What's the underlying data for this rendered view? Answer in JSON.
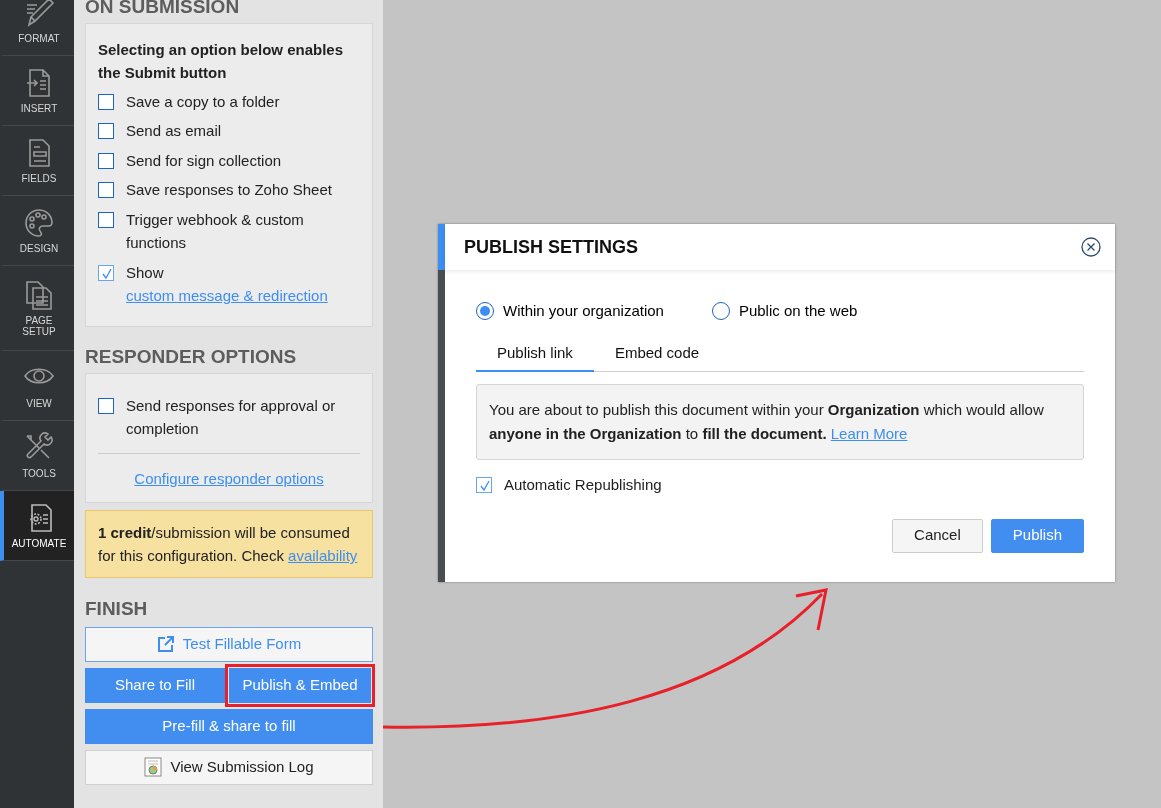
{
  "sidebar": {
    "items": [
      {
        "label": "FORMAT",
        "selected": false
      },
      {
        "label": "INSERT",
        "selected": false
      },
      {
        "label": "FIELDS",
        "selected": false
      },
      {
        "label": "DESIGN",
        "selected": false
      },
      {
        "label": "PAGE SETUP",
        "selected": false
      },
      {
        "label": "VIEW",
        "selected": false
      },
      {
        "label": "TOOLS",
        "selected": false
      },
      {
        "label": "AUTOMATE",
        "selected": true
      }
    ]
  },
  "on_submission": {
    "heading": "ON SUBMISSION",
    "intro": "Selecting an option below enables the Submit button",
    "options": [
      {
        "label": "Save a copy to a folder",
        "checked": false
      },
      {
        "label": "Send as email",
        "checked": false
      },
      {
        "label": "Send for sign collection",
        "checked": false
      },
      {
        "label": "Save responses to Zoho Sheet",
        "checked": false
      },
      {
        "label": "Trigger webhook & custom functions",
        "checked": false
      },
      {
        "label": "Show",
        "link": "custom message & redirection",
        "checked": true
      }
    ]
  },
  "responder_options": {
    "heading": "RESPONDER OPTIONS",
    "option": {
      "label": "Send responses for approval or completion",
      "checked": false
    },
    "link": "Configure responder options"
  },
  "notice": {
    "text": "**1 credit**/submission will be consumed for this configuration. Check",
    "link": "availability"
  },
  "finish": {
    "heading": "FINISH",
    "buttons": [
      {
        "label": "Test Fillable Form",
        "kind": "outline",
        "highlighted": false
      },
      {
        "label": "Share to Fill",
        "kind": "primary",
        "highlighted": false
      },
      {
        "label": "Publish & Embed",
        "kind": "primary",
        "highlighted": true
      },
      {
        "label": "Pre-fill & share to fill",
        "kind": "primary",
        "highlighted": false
      },
      {
        "label": "View Submission Log",
        "kind": "log",
        "highlighted": false
      }
    ]
  },
  "dialog": {
    "title": "PUBLISH SETTINGS",
    "radios": [
      {
        "label": "Within your organization",
        "selected": true
      },
      {
        "label": "Public on the web",
        "selected": false
      }
    ],
    "tabs": [
      {
        "label": "Publish link",
        "selected": true
      },
      {
        "label": "Embed code",
        "selected": false
      }
    ],
    "info": "You are about to publish this document within your **Organization** which would allow **anyone in the Organization** to **fill the document.**",
    "info_link": "Learn More",
    "checkbox": {
      "label": "Automatic Republishing",
      "checked": true
    },
    "buttons": [
      {
        "label": "Cancel",
        "kind": "secondary"
      },
      {
        "label": "Publish",
        "kind": "primary"
      }
    ]
  }
}
